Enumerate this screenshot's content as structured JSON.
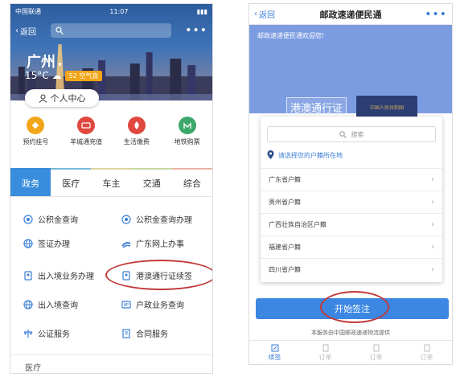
{
  "left": {
    "status": {
      "carrier": "中国联通",
      "time": "11:07"
    },
    "nav": {
      "back": "返回"
    },
    "city": "广州",
    "temperature": "15°C",
    "aqi": "52 空气良",
    "personal_center": "个人中心",
    "quick": [
      {
        "label": "预约挂号",
        "color": "#f2a516",
        "icon": "register-icon"
      },
      {
        "label": "羊城通充值",
        "color": "#e0473f",
        "icon": "card-icon"
      },
      {
        "label": "生活缴费",
        "color": "#e0473f",
        "icon": "fire-icon"
      },
      {
        "label": "地铁购票",
        "color": "#3da86b",
        "icon": "metro-icon"
      }
    ],
    "tabs": [
      "政务",
      "医疗",
      "车主",
      "交通",
      "综合"
    ],
    "services": [
      {
        "label": "公积金查询",
        "icon": "fund-icon"
      },
      {
        "label": "公积金查询办理",
        "icon": "fund-icon"
      },
      {
        "label": "签证办理",
        "icon": "globe-icon"
      },
      {
        "label": "广东网上办事",
        "icon": "guangdong-icon"
      },
      {
        "label": "出入境业务办理",
        "icon": "passport-icon"
      },
      {
        "label": "港澳通行证续签",
        "icon": "passport-icon"
      },
      {
        "label": "出入境查询",
        "icon": "globe-icon"
      },
      {
        "label": "户政业务查询",
        "icon": "id-card-icon"
      },
      {
        "label": "公证服务",
        "icon": "scale-icon"
      },
      {
        "label": "合同服务",
        "icon": "contract-icon"
      }
    ],
    "section2": "医疗"
  },
  "right": {
    "nav": {
      "back": "返回",
      "title": "邮政速递便民通"
    },
    "welcome": "邮政速递便民通欢迎您!",
    "permit_text": "港澳通行证",
    "passport_text": "中国人民共和国",
    "search_placeholder": "搜索",
    "location_prompt": "请选择您的户籍所在地",
    "provinces": [
      "广东省户籍",
      "贵州省户籍",
      "广西壮族自治区户籍",
      "福建省户籍",
      "四川省户籍"
    ],
    "start_button": "开始签注",
    "footnote": "本服务由中国邮政速递物流提供",
    "tabbar": [
      "续签",
      "订单",
      "订单",
      "订单"
    ]
  },
  "colors": {
    "accent": "#3a8ddc",
    "highlight_ring": "#c13a3a",
    "right_hero": "#7c9ce2"
  }
}
